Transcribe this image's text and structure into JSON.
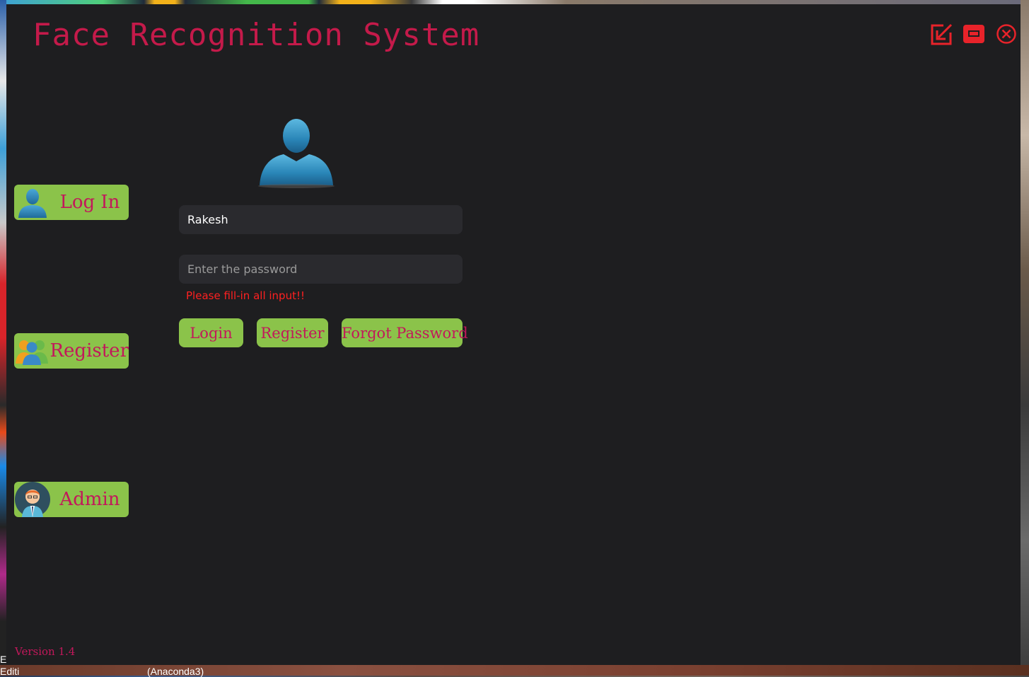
{
  "app": {
    "title": "Face Recognition System",
    "version": "Version 1.4"
  },
  "window_controls": {
    "minimize_icon": "minimize-arrow-icon",
    "maximize_icon": "maximize-box-icon",
    "close_icon": "close-circle-icon"
  },
  "sidebar": {
    "items": [
      {
        "label": "Log In",
        "icon": "user-silhouette-icon"
      },
      {
        "label": "Register",
        "icon": "users-group-icon"
      },
      {
        "label": "Admin",
        "icon": "admin-avatar-icon"
      }
    ]
  },
  "login_form": {
    "avatar_icon": "user-avatar-icon",
    "username_value": "Rakesh",
    "password_placeholder": "Enter the password",
    "error": "Please fill-in all input!!",
    "buttons": {
      "login": "Login",
      "register": "Register",
      "forgot": "Forgot Password"
    }
  },
  "desktop": {
    "bottom_label": "(Anaconda3)",
    "left_label_1": "E",
    "left_label_2": "Editi"
  },
  "colors": {
    "accent": "#c41a4a",
    "button_bg": "#8bc34a",
    "window_bg": "#1e1e20",
    "error": "#ff2020"
  }
}
